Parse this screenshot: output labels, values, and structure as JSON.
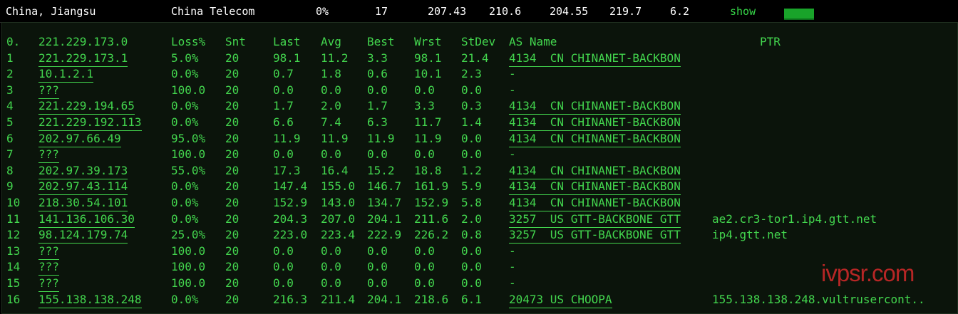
{
  "summary": {
    "location": "China, Jiangsu",
    "isp": "China Telecom",
    "loss": "0%",
    "sent": "17",
    "last": "207.43",
    "avg": "210.6",
    "best": "204.55",
    "worst": "219.7",
    "stdev": "6.2",
    "show_label": "show",
    "latency_bar_fraction": 1.0,
    "colors": {
      "text": "#ffffff",
      "accent": "#36d648",
      "bar": "#19a32a"
    }
  },
  "table": {
    "headers": {
      "hop": "0.",
      "host": "221.229.173.0",
      "loss": "Loss%",
      "snt": "Snt",
      "last": "Last",
      "avg": "Avg",
      "best": "Best",
      "wrst": "Wrst",
      "stdev": "StDev",
      "as_name": "AS Name",
      "ptr": "PTR"
    },
    "rows": [
      {
        "hop": "1",
        "host": "221.229.173.1",
        "loss": "5.0%",
        "snt": "20",
        "last": "98.1",
        "avg": "11.2",
        "best": "3.3",
        "wrst": "98.1",
        "stdev": "21.4",
        "as": "4134  CN CHINANET-BACKBON",
        "ptr": ""
      },
      {
        "hop": "2",
        "host": "10.1.2.1",
        "loss": "0.0%",
        "snt": "20",
        "last": "0.7",
        "avg": "1.8",
        "best": "0.6",
        "wrst": "10.1",
        "stdev": "2.3",
        "as": "-",
        "ptr": ""
      },
      {
        "hop": "3",
        "host": "???",
        "loss": "100.0",
        "snt": "20",
        "last": "0.0",
        "avg": "0.0",
        "best": "0.0",
        "wrst": "0.0",
        "stdev": "0.0",
        "as": "-",
        "ptr": ""
      },
      {
        "hop": "4",
        "host": "221.229.194.65",
        "loss": "0.0%",
        "snt": "20",
        "last": "1.7",
        "avg": "2.0",
        "best": "1.7",
        "wrst": "3.3",
        "stdev": "0.3",
        "as": "4134  CN CHINANET-BACKBON",
        "ptr": ""
      },
      {
        "hop": "5",
        "host": "221.229.192.113",
        "loss": "0.0%",
        "snt": "20",
        "last": "6.6",
        "avg": "7.4",
        "best": "6.3",
        "wrst": "11.7",
        "stdev": "1.4",
        "as": "4134  CN CHINANET-BACKBON",
        "ptr": ""
      },
      {
        "hop": "6",
        "host": "202.97.66.49",
        "loss": "95.0%",
        "snt": "20",
        "last": "11.9",
        "avg": "11.9",
        "best": "11.9",
        "wrst": "11.9",
        "stdev": "0.0",
        "as": "4134  CN CHINANET-BACKBON",
        "ptr": ""
      },
      {
        "hop": "7",
        "host": "???",
        "loss": "100.0",
        "snt": "20",
        "last": "0.0",
        "avg": "0.0",
        "best": "0.0",
        "wrst": "0.0",
        "stdev": "0.0",
        "as": "-",
        "ptr": ""
      },
      {
        "hop": "8",
        "host": "202.97.39.173",
        "loss": "55.0%",
        "snt": "20",
        "last": "17.3",
        "avg": "16.4",
        "best": "15.2",
        "wrst": "18.8",
        "stdev": "1.2",
        "as": "4134  CN CHINANET-BACKBON",
        "ptr": ""
      },
      {
        "hop": "9",
        "host": "202.97.43.114",
        "loss": "0.0%",
        "snt": "20",
        "last": "147.4",
        "avg": "155.0",
        "best": "146.7",
        "wrst": "161.9",
        "stdev": "5.9",
        "as": "4134  CN CHINANET-BACKBON",
        "ptr": ""
      },
      {
        "hop": "10",
        "host": "218.30.54.101",
        "loss": "0.0%",
        "snt": "20",
        "last": "152.9",
        "avg": "143.0",
        "best": "134.7",
        "wrst": "152.9",
        "stdev": "5.8",
        "as": "4134  CN CHINANET-BACKBON",
        "ptr": ""
      },
      {
        "hop": "11",
        "host": "141.136.106.30",
        "loss": "0.0%",
        "snt": "20",
        "last": "204.3",
        "avg": "207.0",
        "best": "204.1",
        "wrst": "211.6",
        "stdev": "2.0",
        "as": "3257  US GTT-BACKBONE GTT",
        "ptr": "ae2.cr3-tor1.ip4.gtt.net"
      },
      {
        "hop": "12",
        "host": "98.124.179.74",
        "loss": "25.0%",
        "snt": "20",
        "last": "223.0",
        "avg": "223.4",
        "best": "222.9",
        "wrst": "226.2",
        "stdev": "0.8",
        "as": "3257  US GTT-BACKBONE GTT",
        "ptr": "ip4.gtt.net"
      },
      {
        "hop": "13",
        "host": "???",
        "loss": "100.0",
        "snt": "20",
        "last": "0.0",
        "avg": "0.0",
        "best": "0.0",
        "wrst": "0.0",
        "stdev": "0.0",
        "as": "-",
        "ptr": ""
      },
      {
        "hop": "14",
        "host": "???",
        "loss": "100.0",
        "snt": "20",
        "last": "0.0",
        "avg": "0.0",
        "best": "0.0",
        "wrst": "0.0",
        "stdev": "0.0",
        "as": "-",
        "ptr": ""
      },
      {
        "hop": "15",
        "host": "???",
        "loss": "100.0",
        "snt": "20",
        "last": "0.0",
        "avg": "0.0",
        "best": "0.0",
        "wrst": "0.0",
        "stdev": "0.0",
        "as": "-",
        "ptr": ""
      },
      {
        "hop": "16",
        "host": "155.138.138.248",
        "loss": "0.0%",
        "snt": "20",
        "last": "216.3",
        "avg": "211.4",
        "best": "204.1",
        "wrst": "218.6",
        "stdev": "6.1",
        "as": "20473 US CHOOPA",
        "ptr": "155.138.138.248.vultrusercont.."
      }
    ]
  },
  "watermark": "ivpsr.com",
  "colors": {
    "terminal_green": "#43d64e",
    "panel_bg": "#0b140b",
    "watermark": "#d42a2a"
  }
}
